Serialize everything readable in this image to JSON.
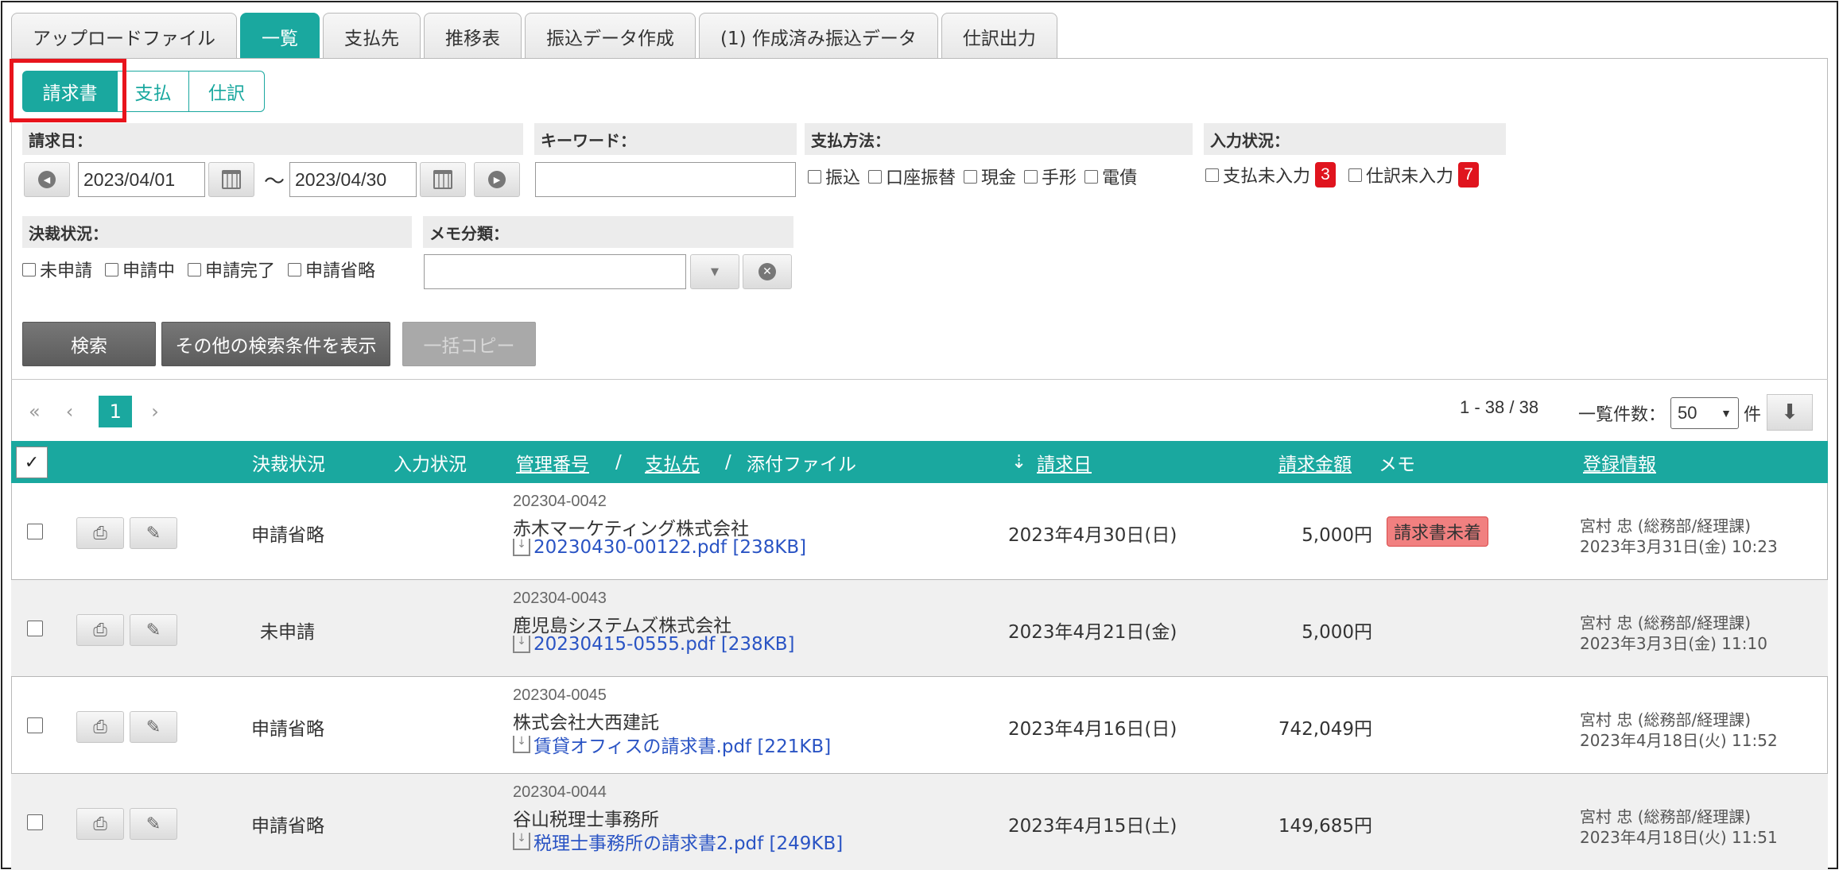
{
  "tabs": [
    "アップロードファイル",
    "一覧",
    "支払先",
    "推移表",
    "振込データ作成",
    "(1) 作成済み振込データ",
    "仕訳出力"
  ],
  "subtabs": [
    "請求書",
    "支払",
    "仕訳"
  ],
  "filters": {
    "invoice_date_label": "請求日：",
    "date_from": "2023/04/01",
    "date_sep": "〜",
    "date_to": "2023/04/30",
    "keyword_label": "キーワード：",
    "keyword_value": "",
    "pay_method_label": "支払方法：",
    "pay_methods": [
      "振込",
      "口座振替",
      "現金",
      "手形",
      "電債"
    ],
    "input_status_label": "入力状況：",
    "input_status": [
      {
        "label": "支払未入力",
        "badge": "3"
      },
      {
        "label": "仕訳未入力",
        "badge": "7"
      }
    ],
    "approval_label": "決裁状況：",
    "approval_options": [
      "未申請",
      "申請中",
      "申請完了",
      "申請省略"
    ],
    "memo_label": "メモ分類：",
    "memo_value": ""
  },
  "actions": {
    "search": "検索",
    "more": "その他の検索条件を表示",
    "bulk_copy": "一括コピー"
  },
  "pager": {
    "first": "«",
    "prev": "‹",
    "current": "1",
    "next": "›",
    "range": "1 - 38 / 38",
    "per_page_label": "一覧件数：",
    "per_page": "50",
    "unit": "件"
  },
  "table_header": {
    "check": "✓",
    "approval": "決裁状況",
    "input": "入力状況",
    "mgmt": "管理番号",
    "slash1": "/",
    "vendor": "支払先",
    "slash2": "/",
    "attach": "添付ファイル",
    "sort_icon": "⇣",
    "date": "請求日",
    "amount": "請求金額",
    "memo": "メモ",
    "reg": "登録情報"
  },
  "rows": [
    {
      "status": "申請省略",
      "mgmt": "202304-0042",
      "vendor": "赤木マーケティング株式会社",
      "file": "20230430-00122.pdf [238KB]",
      "date": "2023年4月30日(日)",
      "amount": "5,000円",
      "memo": "請求書未着",
      "reg1": "宮村 忠 (総務部/経理課)",
      "reg2": "2023年3月31日(金) 10:23"
    },
    {
      "status": "未申請",
      "mgmt": "202304-0043",
      "vendor": "鹿児島システムズ株式会社",
      "file": "20230415-0555.pdf [238KB]",
      "date": "2023年4月21日(金)",
      "amount": "5,000円",
      "memo": "",
      "reg1": "宮村 忠 (総務部/経理課)",
      "reg2": "2023年3月3日(金) 11:10"
    },
    {
      "status": "申請省略",
      "mgmt": "202304-0045",
      "vendor": "株式会社大西建託",
      "file": "賃貸オフィスの請求書.pdf [221KB]",
      "date": "2023年4月16日(日)",
      "amount": "742,049円",
      "memo": "",
      "reg1": "宮村 忠 (総務部/経理課)",
      "reg2": "2023年4月18日(火) 11:52"
    },
    {
      "status": "申請省略",
      "mgmt": "202304-0044",
      "vendor": "谷山税理士事務所",
      "file": "税理士事務所の請求書2.pdf [249KB]",
      "date": "2023年4月15日(土)",
      "amount": "149,685円",
      "memo": "",
      "reg1": "宮村 忠 (総務部/経理課)",
      "reg2": "2023年4月18日(火) 11:51"
    }
  ],
  "colors": {
    "accent": "#1aa89f",
    "highlight": "#e8141c",
    "badge": "#e0141e",
    "memo_tag": "#f18080",
    "link": "#2a54c4"
  }
}
